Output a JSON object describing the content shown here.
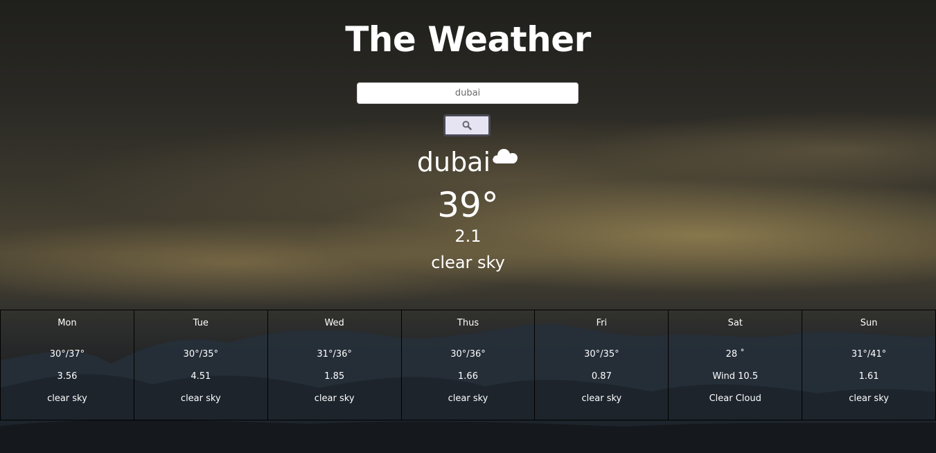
{
  "header": {
    "title": "The Weather"
  },
  "search": {
    "value": "dubai",
    "button_icon": "search-icon"
  },
  "current": {
    "city": "dubai",
    "icon": "cloud-icon",
    "temperature": "39°",
    "wind": "2.1",
    "description": "clear sky"
  },
  "forecast": [
    {
      "day": "Mon",
      "temp": "30°/37°",
      "wind": "3.56",
      "desc": "clear sky"
    },
    {
      "day": "Tue",
      "temp": "30°/35°",
      "wind": "4.51",
      "desc": "clear sky"
    },
    {
      "day": "Wed",
      "temp": "31°/36°",
      "wind": "1.85",
      "desc": "clear sky"
    },
    {
      "day": "Thus",
      "temp": "30°/36°",
      "wind": "1.66",
      "desc": "clear sky"
    },
    {
      "day": "Fri",
      "temp": "30°/35°",
      "wind": "0.87",
      "desc": "clear sky"
    },
    {
      "day": "Sat",
      "temp": "28 ˚",
      "wind": "Wind 10.5",
      "desc": "Clear Cloud"
    },
    {
      "day": "Sun",
      "temp": "31°/41°",
      "wind": "1.61",
      "desc": "clear sky"
    }
  ],
  "colors": {
    "button_bg": "#e6e4f2",
    "button_border": "#4a4a55",
    "text": "#ffffff"
  }
}
